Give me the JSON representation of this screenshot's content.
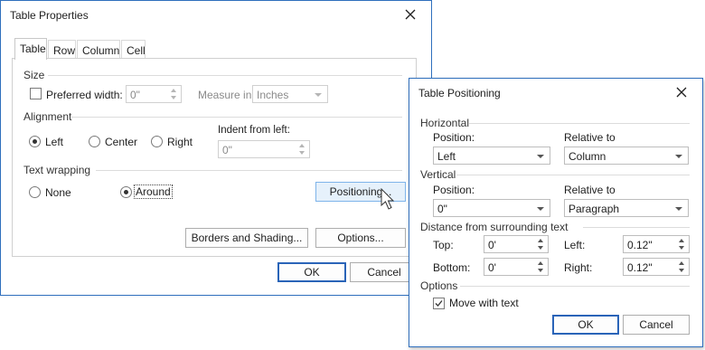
{
  "table_properties": {
    "title": "Table Properties",
    "tabs": [
      {
        "label": "Table"
      },
      {
        "label": "Row"
      },
      {
        "label": "Column"
      },
      {
        "label": "Cell"
      }
    ],
    "size": {
      "section": "Size",
      "preferred_width_label": "Preferred width:",
      "preferred_width_value": "0\"",
      "measure_in_label": "Measure in:",
      "measure_in_value": "Inches"
    },
    "alignment": {
      "section": "Alignment",
      "left": "Left",
      "center": "Center",
      "right": "Right",
      "selected": "Left",
      "indent_label": "Indent from left:",
      "indent_value": "0\""
    },
    "text_wrapping": {
      "section": "Text wrapping",
      "none": "None",
      "around": "Around",
      "selected": "Around",
      "positioning_button": "Positioning..."
    },
    "borders_button": "Borders and Shading...",
    "options_button": "Options...",
    "ok": "OK",
    "cancel": "Cancel"
  },
  "table_positioning": {
    "title": "Table Positioning",
    "horizontal": {
      "section": "Horizontal",
      "position_label": "Position:",
      "position_value": "Left",
      "relative_label": "Relative to",
      "relative_value": "Column"
    },
    "vertical": {
      "section": "Vertical",
      "position_label": "Position:",
      "position_value": "0\"",
      "relative_label": "Relative to",
      "relative_value": "Paragraph"
    },
    "distance": {
      "section": "Distance from surrounding text",
      "top_label": "Top:",
      "top_value": "0'",
      "bottom_label": "Bottom:",
      "bottom_value": "0'",
      "left_label": "Left:",
      "left_value": "0.12\"",
      "right_label": "Right:",
      "right_value": "0.12\""
    },
    "options": {
      "section": "Options",
      "move_with_text": "Move with text",
      "move_with_text_checked": true
    },
    "ok": "OK",
    "cancel": "Cancel"
  },
  "colors": {
    "accent": "#2a64b8",
    "border": "#2f6fbd"
  }
}
